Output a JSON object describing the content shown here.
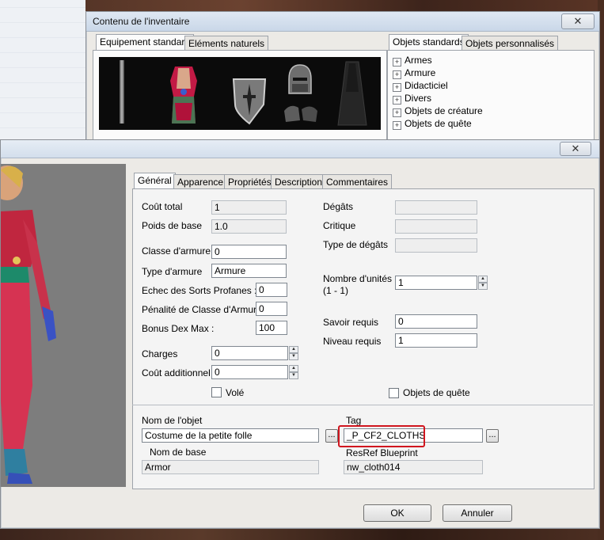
{
  "inventory_window": {
    "title": "Contenu de l'inventaire",
    "close_label": "✕",
    "left_tabs": [
      "Equipement standard",
      "Eléments naturels"
    ],
    "right_tabs": [
      "Objets standards",
      "Objets personnalisés"
    ],
    "tree_items": [
      "Armes",
      "Armure",
      "Didacticiel",
      "Divers",
      "Objets de créature",
      "Objets de quête"
    ],
    "tree_expander": "+"
  },
  "item_window": {
    "close_label": "✕",
    "tabs": [
      "Général",
      "Apparence",
      "Propriétés",
      "Description",
      "Commentaires"
    ],
    "left_fields": {
      "cout_total": {
        "label": "Coût total",
        "value": "1"
      },
      "poids_de_base": {
        "label": "Poids de base",
        "value": "1.0"
      },
      "classe_armure": {
        "label": "Classe d'armure",
        "value": "0"
      },
      "type_armure": {
        "label": "Type d'armure",
        "value": "Armure"
      },
      "echec_sorts": {
        "label": "Echec des Sorts Profanes :",
        "value": "0"
      },
      "penalite_ca": {
        "label": "Pénalité de Classe d'Armure :",
        "value": "0"
      },
      "bonus_dex": {
        "label": "Bonus Dex Max :",
        "value": "100"
      },
      "charges": {
        "label": "Charges",
        "value": "0"
      },
      "cout_additionnel": {
        "label": "Coût additionnel",
        "value": "0"
      }
    },
    "vole_label": "Volé",
    "right_fields": {
      "degats": {
        "label": "Dégâts",
        "value": ""
      },
      "critique": {
        "label": "Critique",
        "value": ""
      },
      "type_degats": {
        "label": "Type de dégâts",
        "value": ""
      },
      "nombre_unites": {
        "label": "Nombre d'unités",
        "sub": "(1 - 1)",
        "value": "1"
      },
      "savoir_requis": {
        "label": "Savoir requis",
        "value": "0"
      },
      "niveau_requis": {
        "label": "Niveau requis",
        "value": "1"
      }
    },
    "objets_quete_label": "Objets de quête",
    "nom_objet": {
      "label": "Nom de l'objet",
      "value": "Costume de la petite folle"
    },
    "tag": {
      "label": "Tag",
      "value": "_P_CF2_CLOTHS"
    },
    "nom_de_base": {
      "label": "Nom de base",
      "value": "Armor"
    },
    "resref": {
      "label": "ResRef Blueprint",
      "value": "nw_cloth014"
    },
    "browse_label": "...",
    "ok_label": "OK",
    "cancel_label": "Annuler"
  },
  "colors": {
    "highlight": "#d0161f",
    "title_bar": "#d3deec"
  }
}
